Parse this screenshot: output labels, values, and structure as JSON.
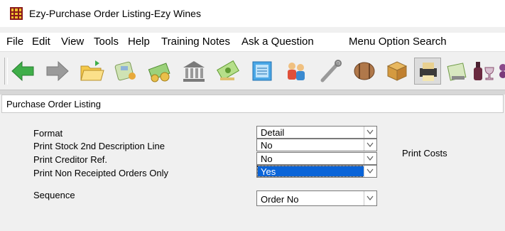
{
  "window": {
    "title": "Ezy-Purchase Order Listing-Ezy Wines"
  },
  "menu": [
    "File",
    "Edit",
    "View",
    "Tools",
    "Help",
    "Training Notes",
    "Ask a Question",
    "Menu Option Search"
  ],
  "toolbar": {
    "buttons": [
      "back-arrow-icon",
      "forward-arrow-icon",
      "open-folder-icon",
      "phone-icon",
      "money-icon",
      "bank-icon",
      "payment-icon",
      "report-icon",
      "people-icon",
      "tools-icon",
      "barrel-icon",
      "box-icon",
      "printer-icon",
      "ledger-icon",
      "wine-icon",
      "grapes-icon"
    ],
    "active_button": "printer-icon"
  },
  "panel": {
    "title": "Purchase Order Listing"
  },
  "form": {
    "format": {
      "label": "Format",
      "value": "Detail"
    },
    "print_stock_2nd": {
      "label": "Print Stock 2nd Description Line",
      "value": "No"
    },
    "print_creditor_ref": {
      "label": "Print Creditor Ref.",
      "value": "No"
    },
    "print_non_receipted": {
      "label": "Print Non Receipted Orders Only",
      "value": "Yes"
    },
    "sequence": {
      "label": "Sequence",
      "value": "Order No"
    },
    "print_costs": {
      "label": "Print Costs"
    }
  },
  "colors": {
    "selection": "#0a64d8",
    "accent_green": "#3fae49",
    "app_icon": "#8b1a1a"
  }
}
